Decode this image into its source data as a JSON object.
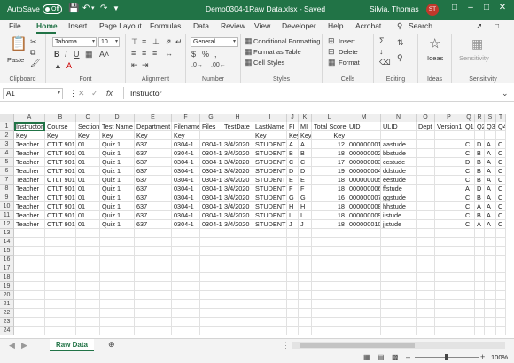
{
  "titlebar": {
    "autosave_label": "AutoSave",
    "autosave_state": "Off",
    "filename": "Demo0304-1Raw Data.xlsx  -  Saved",
    "user": "Silvia, Thomas",
    "initials": "ST"
  },
  "menu": [
    "File",
    "Home",
    "Insert",
    "Page Layout",
    "Formulas",
    "Data",
    "Review",
    "View",
    "Developer",
    "Help",
    "Acrobat"
  ],
  "search_label": "Search",
  "ribbon": {
    "clipboard": {
      "label": "Clipboard",
      "paste": "Paste"
    },
    "font": {
      "label": "Font",
      "name": "Tahoma",
      "size": "10"
    },
    "alignment": {
      "label": "Alignment"
    },
    "number": {
      "label": "Number",
      "format": "General"
    },
    "styles": {
      "label": "Styles",
      "conditional": "Conditional Formatting",
      "table": "Format as Table",
      "cell": "Cell Styles"
    },
    "cells": {
      "label": "Cells",
      "insert": "Insert",
      "delete": "Delete",
      "format": "Format"
    },
    "editing": {
      "label": "Editing"
    },
    "ideas": {
      "label": "Ideas",
      "btn": "Ideas"
    },
    "sensitivity": {
      "label": "Sensitivity",
      "btn": "Sensitivity"
    }
  },
  "formula": {
    "namebox": "A1",
    "content": "Instructor",
    "fx": "fx"
  },
  "columns": [
    "A",
    "B",
    "C",
    "D",
    "E",
    "F",
    "G",
    "H",
    "I",
    "J",
    "K",
    "L",
    "M",
    "N",
    "O",
    "P",
    "Q",
    "R",
    "S",
    "T"
  ],
  "rows": [
    [
      "Instructor",
      "Course",
      "Section",
      "Test Name",
      "Department",
      "Filename",
      "Files",
      "TestDate",
      "LastName",
      "FI",
      "MI",
      "Total Score",
      "UID",
      "ULID",
      "Dept",
      "Version1",
      "Q1",
      "Q2",
      "Q3",
      "Q4"
    ],
    [
      "Key",
      "Key",
      "Key",
      "Key",
      "Key",
      "Key",
      "",
      "",
      "Key",
      "Key",
      "Key",
      "Key",
      "",
      "",
      "",
      "",
      "",
      "",
      "",
      ""
    ],
    [
      "Teacher",
      "CTLT 901",
      "01",
      "Quiz 1",
      "637",
      "0304-1",
      "0304-1",
      "3/4/2020",
      "STUDENT",
      "A",
      "A",
      "12",
      "000000001",
      "aastude",
      "",
      "",
      "C",
      "D",
      "A",
      "C"
    ],
    [
      "Teacher",
      "CTLT 901",
      "01",
      "Quiz 1",
      "637",
      "0304-1",
      "0304-1",
      "3/4/2020",
      "STUDENT",
      "B",
      "B",
      "18",
      "000000002",
      "bbstude",
      "",
      "",
      "C",
      "B",
      "A",
      "C"
    ],
    [
      "Teacher",
      "CTLT 901",
      "01",
      "Quiz 1",
      "637",
      "0304-1",
      "0304-1",
      "3/4/2020",
      "STUDENT",
      "C",
      "C",
      "17",
      "000000003",
      "ccstude",
      "",
      "",
      "D",
      "B",
      "A",
      "C"
    ],
    [
      "Teacher",
      "CTLT 901",
      "01",
      "Quiz 1",
      "637",
      "0304-1",
      "0304-1",
      "3/4/2020",
      "STUDENT",
      "D",
      "D",
      "19",
      "000000004",
      "ddstude",
      "",
      "",
      "C",
      "B",
      "A",
      "C"
    ],
    [
      "Teacher",
      "CTLT 901",
      "01",
      "Quiz 1",
      "637",
      "0304-1",
      "0304-1",
      "3/4/2020",
      "STUDENT",
      "E",
      "E",
      "18",
      "000000005",
      "eestude",
      "",
      "",
      "C",
      "B",
      "A",
      "C"
    ],
    [
      "Teacher",
      "CTLT 901",
      "01",
      "Quiz 1",
      "637",
      "0304-1",
      "0304-1",
      "3/4/2020",
      "STUDENT",
      "F",
      "F",
      "18",
      "000000006",
      "ffstude",
      "",
      "",
      "A",
      "D",
      "A",
      "C"
    ],
    [
      "Teacher",
      "CTLT 901",
      "01",
      "Quiz 1",
      "637",
      "0304-1",
      "0304-1",
      "3/4/2020",
      "STUDENT",
      "G",
      "G",
      "16",
      "000000007",
      "ggstude",
      "",
      "",
      "C",
      "B",
      "A",
      "C"
    ],
    [
      "Teacher",
      "CTLT 901",
      "01",
      "Quiz 1",
      "637",
      "0304-1",
      "0304-1",
      "3/4/2020",
      "STUDENT",
      "H",
      "H",
      "18",
      "000000008",
      "hhstude",
      "",
      "",
      "C",
      "A",
      "A",
      "C"
    ],
    [
      "Teacher",
      "CTLT 901",
      "01",
      "Quiz 1",
      "637",
      "0304-1",
      "0304-1",
      "3/4/2020",
      "STUDENT",
      "I",
      "I",
      "18",
      "000000009",
      "iistude",
      "",
      "",
      "C",
      "B",
      "A",
      "C"
    ],
    [
      "Teacher",
      "CTLT 901",
      "01",
      "Quiz 1",
      "637",
      "0304-1",
      "0304-1",
      "3/4/2020",
      "STUDENT",
      "J",
      "J",
      "18",
      "000000010",
      "jjstude",
      "",
      "",
      "C",
      "A",
      "A",
      "C"
    ]
  ],
  "total_rows": 24,
  "sheet_tab": "Raw Data",
  "status": {
    "zoom": "100%"
  }
}
